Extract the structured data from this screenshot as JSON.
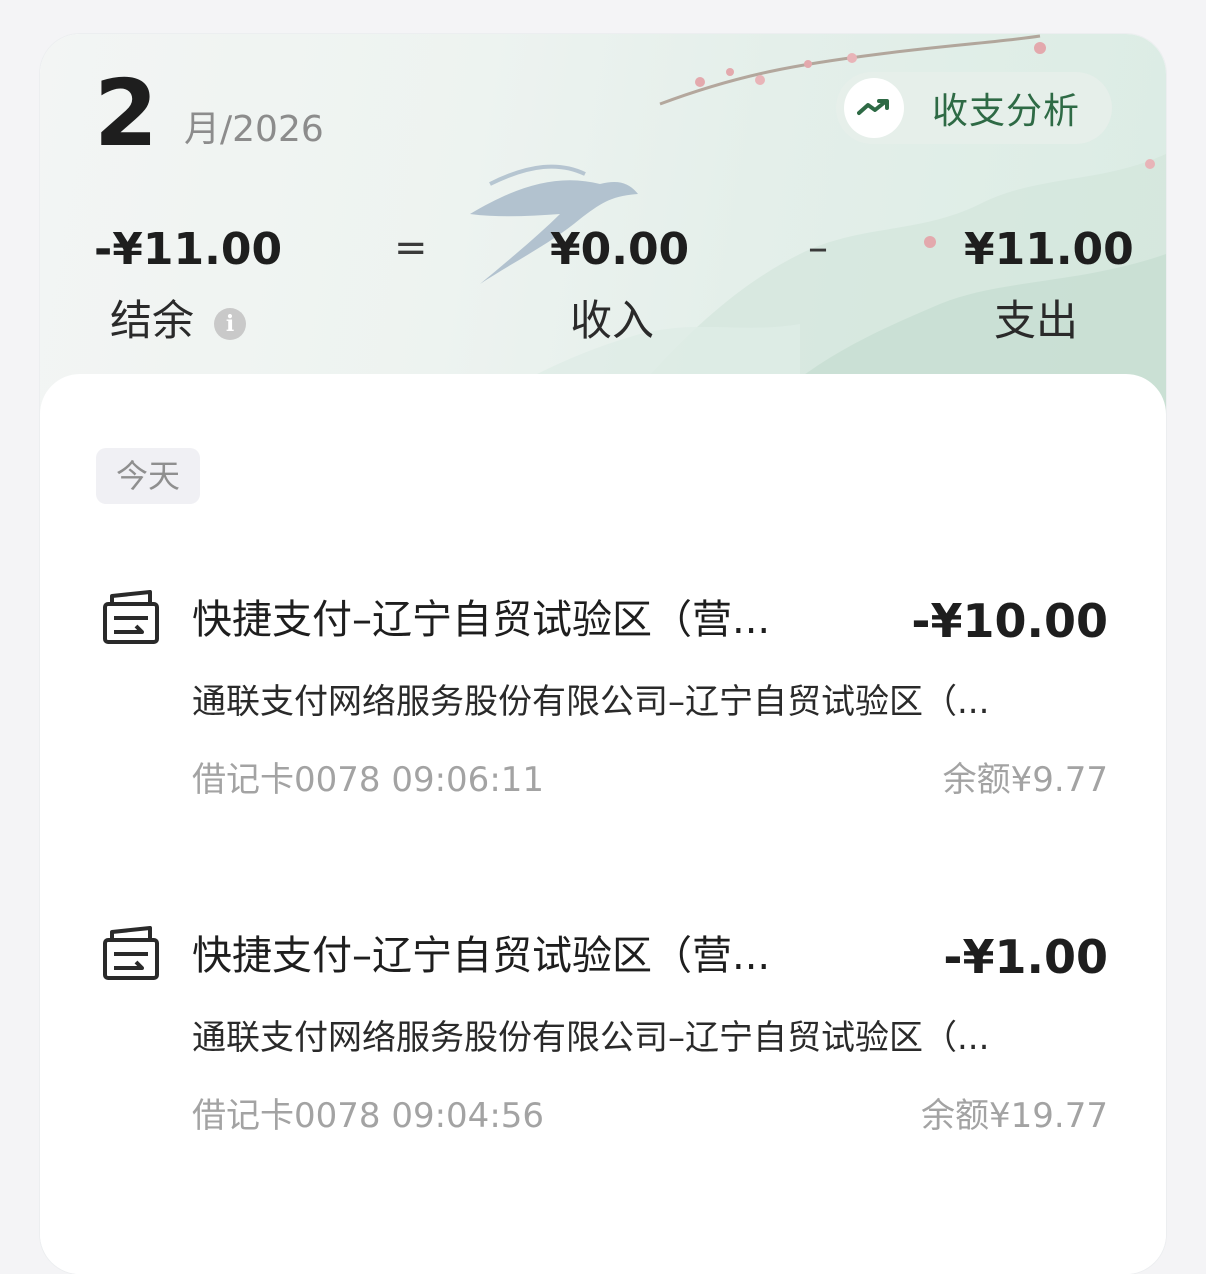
{
  "header": {
    "month_number": "2",
    "month_suffix": "月/2026",
    "analysis_button": {
      "label": "收支分析",
      "icon": "trend-up-icon",
      "accent_color": "#2e6a45"
    }
  },
  "summary": {
    "balance": {
      "value": "-¥11.00",
      "label": "结余",
      "info_icon": "info-icon"
    },
    "equals": "=",
    "income": {
      "value": "¥0.00",
      "label": "收入"
    },
    "minus": "–",
    "expense": {
      "value": "¥11.00",
      "label": "支出"
    }
  },
  "transactions_section": {
    "day_label": "今天",
    "items": [
      {
        "icon": "receipt-icon",
        "title": "快捷支付–辽宁自贸试验区（营...",
        "amount": "-¥10.00",
        "merchant": "通联支付网络服务股份有限公司–辽宁自贸试验区（...",
        "meta": "借记卡0078 09:06:11",
        "balance": "余额¥9.77"
      },
      {
        "icon": "receipt-icon",
        "title": "快捷支付–辽宁自贸试验区（营...",
        "amount": "-¥1.00",
        "merchant": "通联支付网络服务股份有限公司–辽宁自贸试验区（...",
        "meta": "借记卡0078 09:04:56",
        "balance": "余额¥19.77"
      }
    ]
  }
}
